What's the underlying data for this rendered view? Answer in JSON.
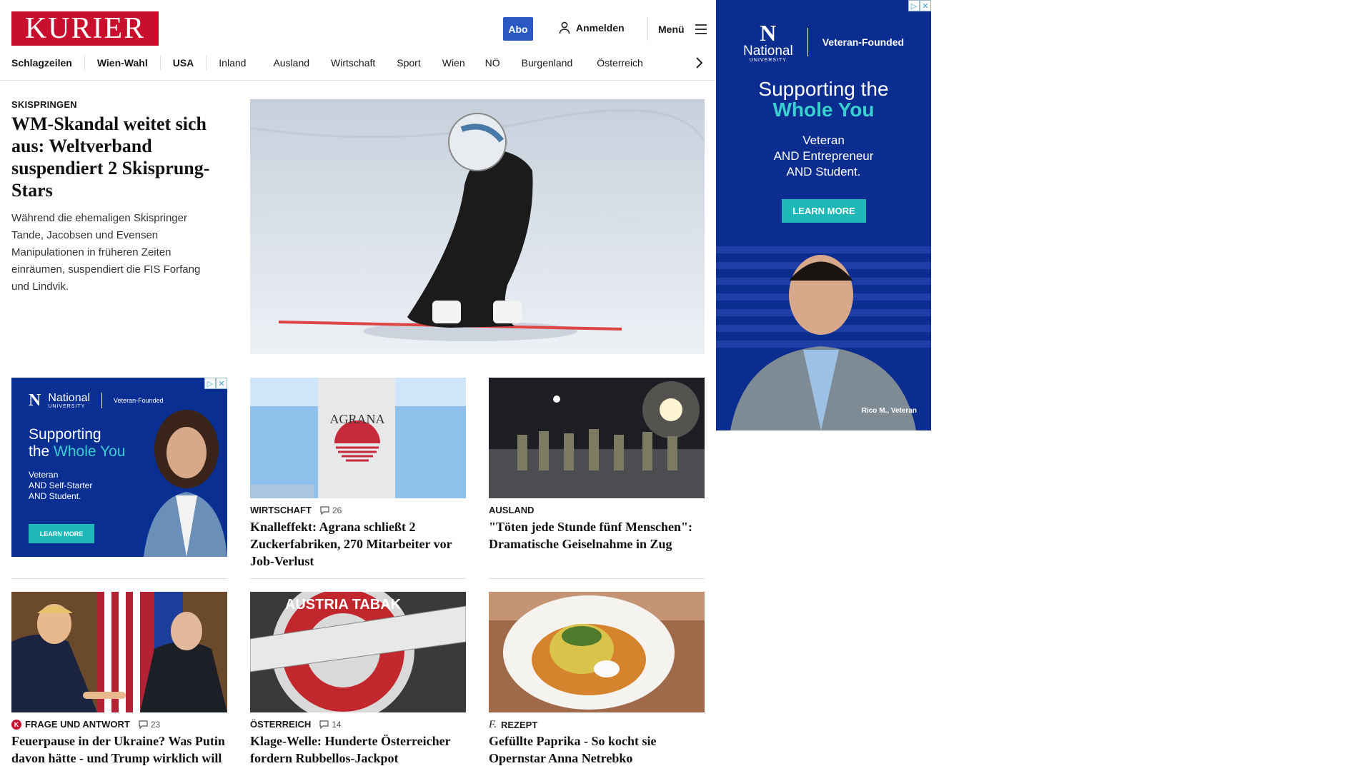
{
  "header": {
    "logo": "KURIER",
    "abo_label": "Abo",
    "login_label": "Anmelden",
    "menu_label": "Menü"
  },
  "nav": {
    "items": [
      "Schlagzeilen",
      "Wien-Wahl",
      "USA",
      "Inland",
      "Ausland",
      "Wirtschaft",
      "Sport",
      "Wien",
      "NÖ",
      "Burgenland",
      "Österreich"
    ]
  },
  "lead": {
    "kicker": "SKISPRINGEN",
    "title": "WM-Skandal weitet sich aus: Weltverband suspendiert 2 Skisprung-Stars",
    "teaser": "Während die ehemaligen Skispringer Tande, Jacobsen und Evensen Manipulationen in früheren Zeiten einräumen, suspendiert die FIS Forfang und Lindvik."
  },
  "cards": [
    {
      "kicker": "WIRTSCHAFT",
      "comments": "26",
      "title": "Knalleffekt: Agrana schließt 2 Zuckerfabriken, 270 Mitarbeiter vor Job-Verlust",
      "image_text": "AGRANA"
    },
    {
      "kicker": "AUSLAND",
      "comments": "",
      "title": "\"Töten jede Stunde fünf Menschen\": Dramatische Geiselnahme in Zug"
    },
    {
      "kicker": "FRAGE UND ANTWORT",
      "comments": "23",
      "title": "Feuerpause in der Ukraine? Was Putin davon hätte - und Trump wirklich will"
    },
    {
      "kicker": "ÖSTERREICH",
      "comments": "14",
      "title": "Klage-Welle: Hunderte Österreicher fordern Rubbellos-Jackpot",
      "image_text": "AUSTRIA TABAK"
    },
    {
      "kicker": "REZEPT",
      "comments": "",
      "title": "Gefüllte Paprika - So kocht sie Opernstar Anna Netrebko"
    }
  ],
  "inline_ad": {
    "brand": "National",
    "brand_sub": "UNIVERSITY",
    "tagline": "Veteran-Founded",
    "headline_1": "Supporting",
    "headline_2a": "the ",
    "headline_2b": "Whole You",
    "line1": "Veteran",
    "line2": "AND Self-Starter",
    "line3": "AND Student.",
    "cta": "LEARN MORE"
  },
  "side_ad": {
    "brand": "National",
    "brand_sub": "UNIVERSITY",
    "tagline": "Veteran-Founded",
    "headline_1": "Supporting the",
    "headline_2": "Whole You",
    "line1": "Veteran",
    "line2": "AND Entrepreneur",
    "line3": "AND Student.",
    "cta": "LEARN MORE",
    "caption": "Rico M., Veteran"
  }
}
